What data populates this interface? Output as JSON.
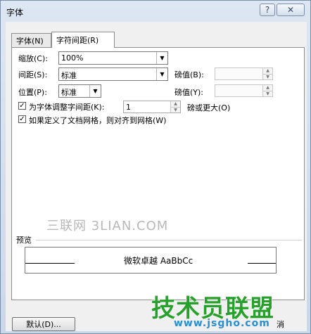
{
  "window": {
    "title": "字体",
    "help_label": "?",
    "close_label": "✕"
  },
  "tabs": [
    {
      "label": "字体(N)"
    },
    {
      "label": "字符间距(R)"
    }
  ],
  "scale": {
    "label": "缩放(C):",
    "value": "100%"
  },
  "spacing": {
    "label": "间距(S):",
    "value": "标准",
    "by_label": "磅值(B):",
    "by_value": ""
  },
  "position": {
    "label": "位置(P):",
    "value": "标准",
    "by_label": "磅值(Y):",
    "by_value": ""
  },
  "kerning": {
    "label": "为字体调整字间距(K):",
    "value": "1",
    "suffix": "磅或更大(O)",
    "checked": true
  },
  "snap_grid": {
    "label": "如果定义了文档网格，则对齐到网格(W)",
    "checked": true
  },
  "watermark": "三联网 3LIAN.COM",
  "preview": {
    "label": "预览",
    "sample": "微软卓越 AaBbCc"
  },
  "buttons": {
    "default_label": "默认(D)...",
    "cut_label": "消"
  },
  "branding": {
    "line1": "技术员联盟",
    "line2": "www.jsgho.com"
  },
  "icons": {
    "dropdown": "chevron-down-icon",
    "spin": "spin-arrows-icon",
    "check": "checkmark-icon"
  }
}
